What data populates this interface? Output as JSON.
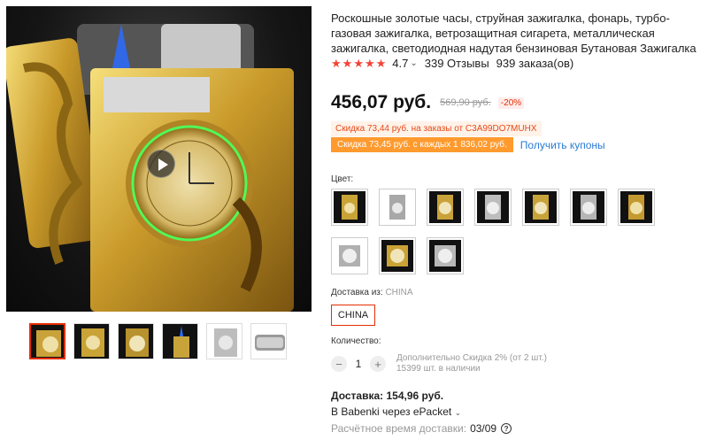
{
  "product": {
    "title": "Роскошные золотые часы, струйная зажигалка, фонарь, турбо-газовая зажигалка, ветрозащитная сигарета, металлическая зажигалка, светодиодная надутая бензиновая Бутановая Зажигалка",
    "rating": "4.7",
    "reviews": "339 Отзывы",
    "orders": "939 заказа(ов)"
  },
  "price": {
    "current": "456,07 руб.",
    "old": "569,90 руб.",
    "discount": "-20%"
  },
  "coupons": {
    "code_offer": "Скидка 73,44 руб. на заказы от C3A99DO7MUHX",
    "every_offer": "Скидка 73,45 руб. с каждых 1 836,02 руб.",
    "get_link": "Получить купоны"
  },
  "color": {
    "label": "Цвет:",
    "swatches": [
      "gold-dragon",
      "silver-dragon",
      "gold-watch",
      "silver-watch",
      "gold-watch-2",
      "silver-watch-2",
      "gold-watch-3",
      "silver-watch-3",
      "gold-watch-4",
      "silver-watch-4"
    ]
  },
  "shipping": {
    "from_label": "Доставка из:",
    "from_value": "CHINA",
    "option": "CHINA"
  },
  "quantity": {
    "label": "Количество:",
    "value": "1",
    "minus": "−",
    "plus": "+",
    "promo": "Дополнительно Скидка 2% (от 2 шт.)",
    "stock": "15399 шт. в наличии"
  },
  "delivery": {
    "price": "Доставка: 154,96 руб.",
    "carrier": "В Babenki через ePacket",
    "eta_label": "Расчётное время доставки:",
    "eta_value": "03/09"
  },
  "gallery": {
    "thumbnails": [
      "lighter-front",
      "lighter-gold",
      "lighter-watch",
      "lighter-flame",
      "lighter-silver",
      "lighter-side"
    ]
  },
  "colors": {
    "accent": "#e62e04",
    "link": "#2a7bd3",
    "star": "#f44336",
    "coupon_bg": "#ff9a2e"
  }
}
